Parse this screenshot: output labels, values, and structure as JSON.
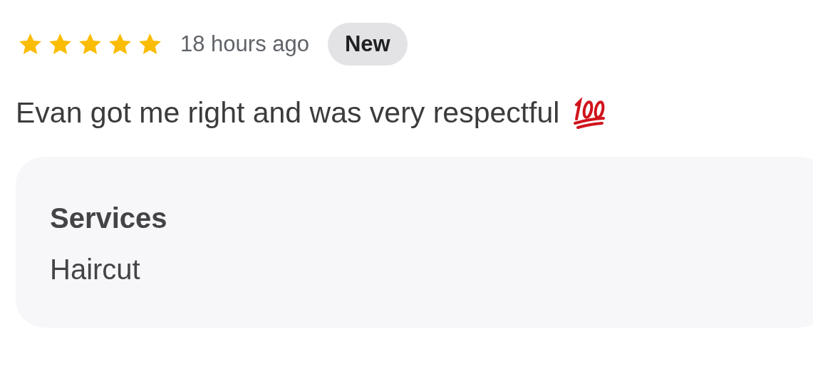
{
  "review": {
    "stars": 5,
    "time": "18 hours ago",
    "badge": "New",
    "text": "Evan got me right and was very respectful",
    "services": {
      "title": "Services",
      "value": "Haircut"
    }
  }
}
